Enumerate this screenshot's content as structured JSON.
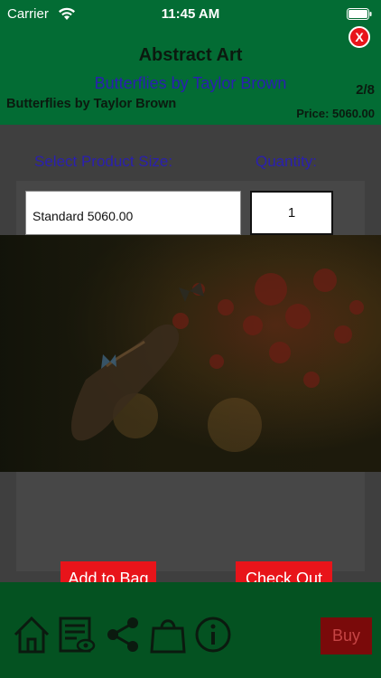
{
  "status_bar": {
    "carrier": "Carrier",
    "time": "11:45 AM",
    "icons": [
      "wifi-icon",
      "battery-icon"
    ]
  },
  "header": {
    "category_title": "Abstract Art",
    "product_title": "Butterflies by Taylor Brown",
    "artist_line": "Butterflies by Taylor Brown",
    "counter": "2/8",
    "price": "Price: 5060.00",
    "close_label": "X"
  },
  "options": {
    "size_label": "Select Product Size:",
    "quantity_label": "Quantity:",
    "selected_size": "Standard 5060.00",
    "quantity_value": "1"
  },
  "actions": {
    "add_to_bag": "Add to Bag",
    "check_out": "Check Out"
  },
  "bottom_bar": {
    "icons": [
      "home-icon",
      "catalog-icon",
      "share-icon",
      "shopping-bag-icon",
      "info-icon"
    ],
    "buy_label": "Buy"
  },
  "colors": {
    "header_green": "#036c34",
    "bottom_green": "#045221",
    "accent_red": "#e8141a",
    "subtitle_blue": "#2a1fb0",
    "content_gray": "#3f3f3f"
  }
}
